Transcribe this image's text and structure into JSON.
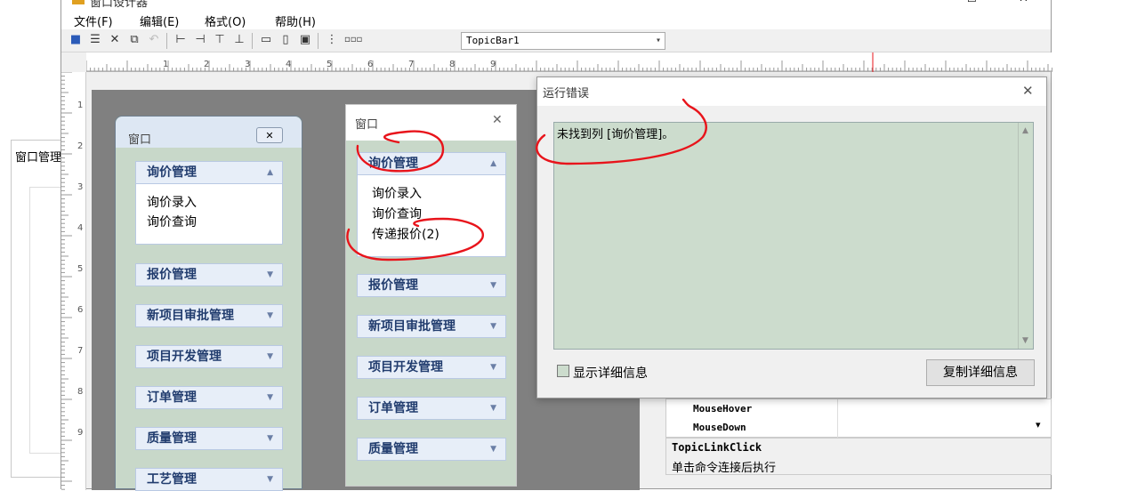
{
  "main": {
    "title": "窗口设计器",
    "menus": [
      "文件(F)",
      "编辑(E)",
      "格式(O)",
      "帮助(H)"
    ],
    "toolbar_combo": "TopicBar1",
    "ruler_h": [
      "1",
      "2",
      "3",
      "4",
      "5",
      "6",
      "7",
      "8",
      "9"
    ],
    "ruler_v": [
      "1",
      "2",
      "3",
      "4",
      "5",
      "6",
      "7",
      "8",
      "9"
    ]
  },
  "side_window": {
    "title": "窗口管理"
  },
  "panel1": {
    "title": "窗口",
    "groups": [
      "询价管理",
      "报价管理",
      "新项目审批管理",
      "项目开发管理",
      "订单管理",
      "质量管理",
      "工艺管理"
    ],
    "subitems": [
      "询价录入",
      "询价查询"
    ]
  },
  "panel2": {
    "title": "窗口",
    "groups": [
      "询价管理",
      "报价管理",
      "新项目审批管理",
      "项目开发管理",
      "订单管理",
      "质量管理"
    ],
    "subitems": [
      "询价录入",
      "询价查询",
      "传递报价(2)"
    ]
  },
  "error_dialog": {
    "title": "运行错误",
    "message": "未找到列 [询价管理]。",
    "show_details": "显示详细信息",
    "copy_button": "复制详细信息"
  },
  "properties": {
    "rows": [
      "MouseHover",
      "MouseDown"
    ],
    "event_name": "TopicLinkClick",
    "event_desc": "单击命令连接后执行"
  },
  "colors": {
    "annotation": "#e8141b",
    "panel_bg": "#c8d8c9",
    "group_text": "#213c6e"
  }
}
